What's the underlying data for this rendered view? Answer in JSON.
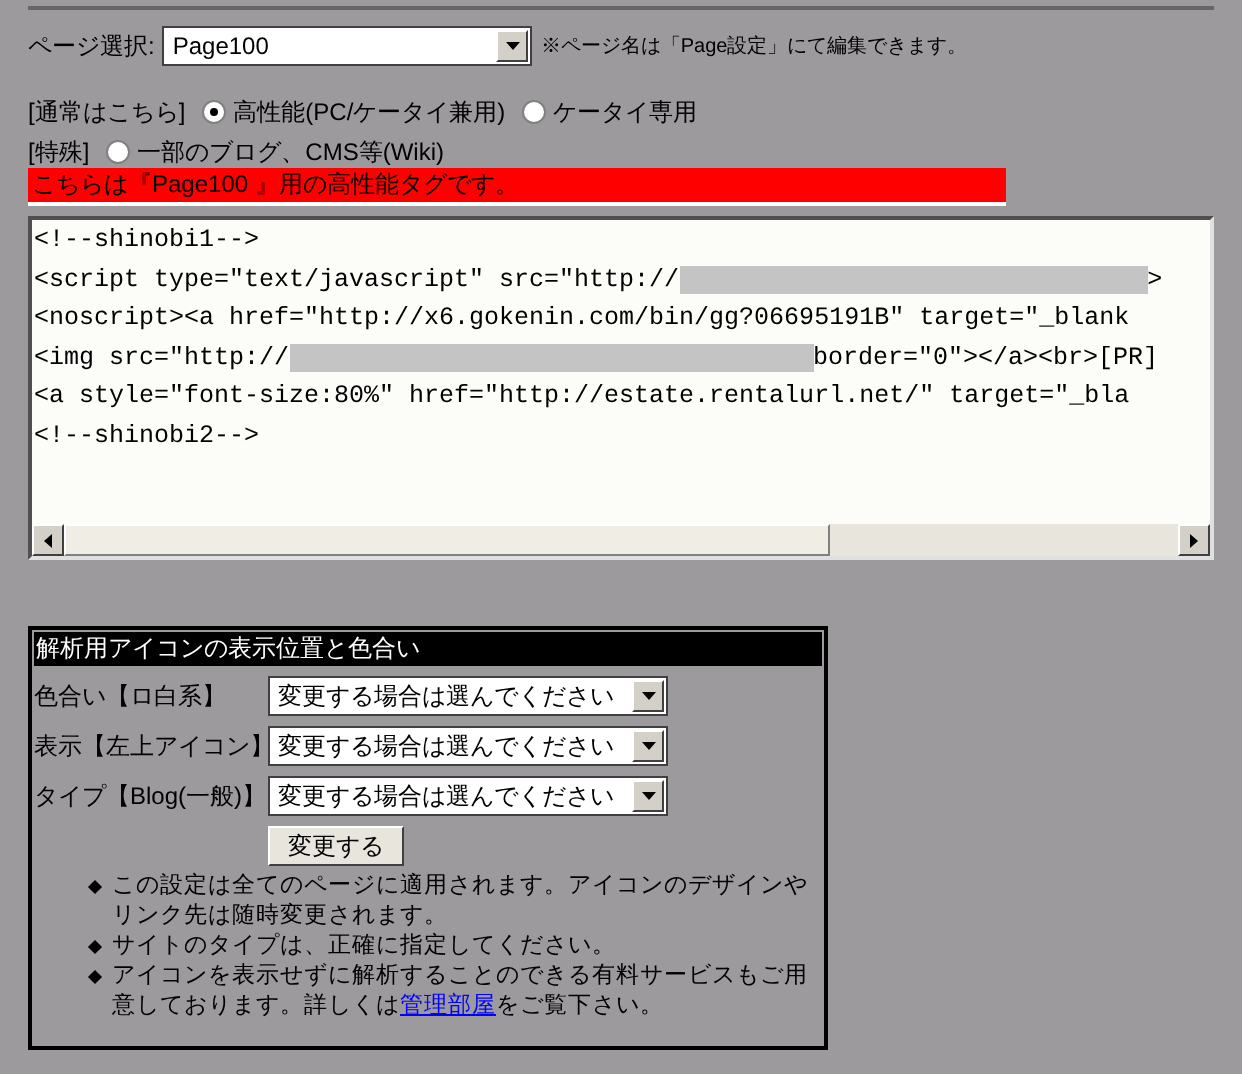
{
  "page_select": {
    "label": "ページ選択:",
    "value": "Page100",
    "note": "※ページ名は「Page設定」にて編集できます。"
  },
  "modes": [
    {
      "prefix": "[通常はこちら]",
      "options": [
        {
          "label": "高性能(PC/ケータイ兼用)",
          "selected": true
        },
        {
          "label": "ケータイ専用",
          "selected": false
        }
      ]
    },
    {
      "prefix": "[特殊]",
      "options": [
        {
          "label": "一部のブログ、CMS等(Wiki)",
          "selected": false
        }
      ]
    }
  ],
  "banner": "こちらは『Page100 』用の高性能タグです。",
  "code_lines": [
    [
      {
        "kind": "text",
        "text": "<!--shinobi1-->"
      }
    ],
    [
      {
        "kind": "text",
        "text": "<script type=\"text/javascript\" src=\"http://"
      },
      {
        "kind": "redacted"
      },
      {
        "kind": "text",
        "text": ">"
      }
    ],
    [
      {
        "kind": "text",
        "text": "<noscript><a href=\"http://x6.gokenin.com/bin/gg?06695191B\" target=\"_blank"
      }
    ],
    [
      {
        "kind": "text",
        "text": "<img src=\"http://"
      },
      {
        "kind": "redacted"
      },
      {
        "kind": "text",
        "text": "border=\"0\"></a><br>[PR]"
      }
    ],
    [
      {
        "kind": "text",
        "text": "<a style=\"font-size:80%\" href=\"http://estate.rentalurl.net/\" target=\"_bla"
      }
    ],
    [
      {
        "kind": "text",
        "text": "<!--shinobi2-->"
      }
    ]
  ],
  "icon_panel": {
    "title": "解析用アイコンの表示位置と色合い",
    "settings": [
      {
        "label": "色合い【ロ白系】",
        "value": "変更する場合は選んでください"
      },
      {
        "label": "表示【左上アイコン】",
        "value": "変更する場合は選んでください"
      },
      {
        "label": "タイプ【Blog(一般)】",
        "value": "変更する場合は選んでください"
      }
    ],
    "button": "変更する",
    "notes": [
      {
        "text": "この設定は全てのページに適用されます。アイコンのデザインやリンク先は随時変更されます。"
      },
      {
        "text": "サイトのタイプは、正確に指定してください。"
      },
      {
        "text": "アイコンを表示せずに解析することのできる有料サービスもご用意しております。詳しくは",
        "link": "管理部屋",
        "after": "をご覧下さい。"
      }
    ]
  }
}
